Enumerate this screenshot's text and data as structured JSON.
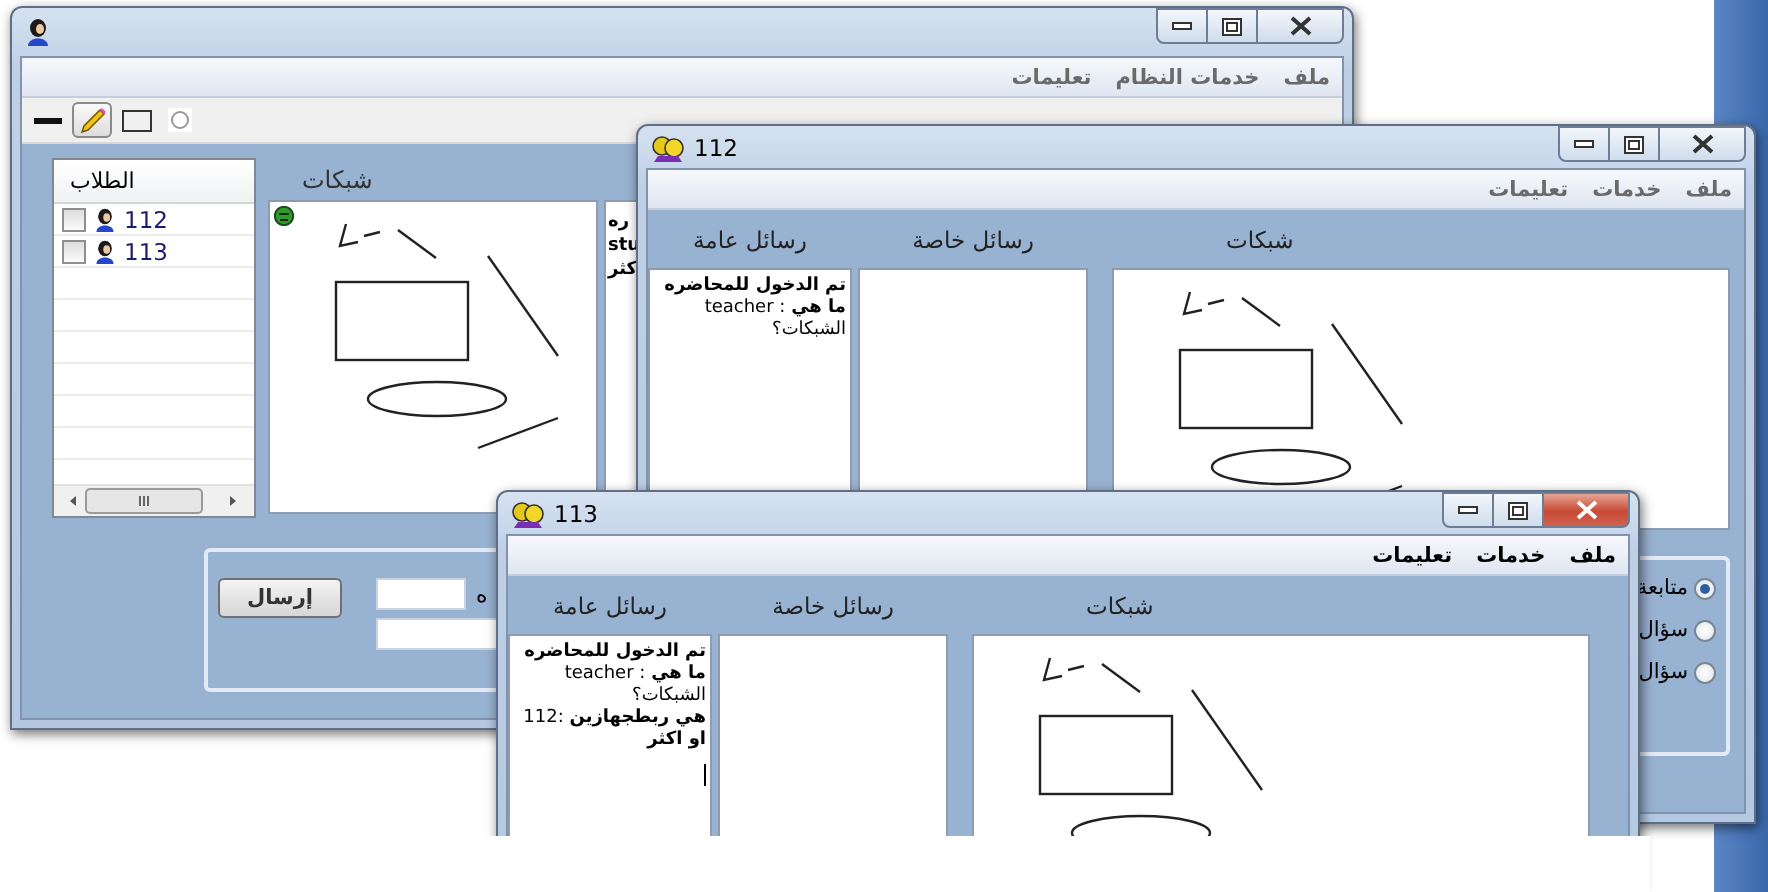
{
  "teacher_window": {
    "active": false,
    "menu": [
      "ملف",
      "خدمات النظام",
      "تعليمات"
    ],
    "tools": [
      {
        "kind": "line",
        "selected": false
      },
      {
        "kind": "pencil",
        "selected": true
      },
      {
        "kind": "rectangle",
        "selected": false
      },
      {
        "kind": "ellipse",
        "selected": false
      }
    ],
    "students_header": "الطلاب",
    "students": [
      {
        "name": "112",
        "checked": false
      },
      {
        "name": "113",
        "checked": false
      }
    ],
    "board_title": "شبكات",
    "messages_partial": [
      "ره",
      "stu",
      "كثر"
    ],
    "send_button": "إرسال",
    "field_label": "ه"
  },
  "student_windows": [
    {
      "title": "112",
      "active": false,
      "menu": [
        "ملف",
        "خدمات",
        "تعليمات"
      ],
      "columns": [
        "شبكات",
        "رسائل خاصة",
        "رسائل عامة"
      ],
      "public_messages": [
        "**تم الدخول للمحاضره**",
        "**ما هي** : teacher",
        "الشبكات؟"
      ],
      "text_caret": false,
      "modes": [
        {
          "label": "متابعة",
          "selected": true
        },
        {
          "label": "سؤال",
          "selected": false
        },
        {
          "label": "سؤال",
          "selected": false
        }
      ]
    },
    {
      "title": "113",
      "active": true,
      "menu": [
        "ملف",
        "خدمات",
        "تعليمات"
      ],
      "columns": [
        "شبكات",
        "رسائل خاصة",
        "رسائل عامة"
      ],
      "public_messages": [
        "**تم الدخول للمحاضره**",
        "**ما هي** : teacher",
        "الشبكات؟",
        "**هي ربطجهازين** :112",
        "**او اكثر**"
      ],
      "text_caret": true
    }
  ]
}
